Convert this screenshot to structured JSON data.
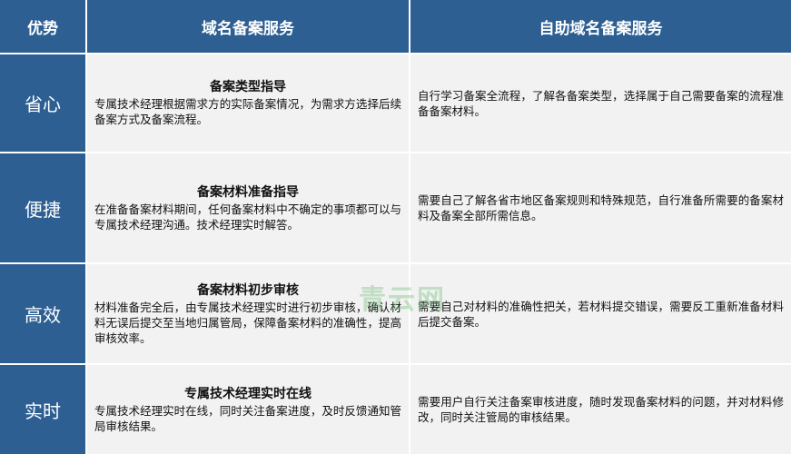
{
  "header": {
    "col1": "优势",
    "col2": "域名备案服务",
    "col3": "自助域名备案服务"
  },
  "rows": [
    {
      "advantage": "省心",
      "service_title": "备案类型指导",
      "service_desc": "专属技术经理根据需求方的实际备案情况，为需求方选择后续备案方式及备案流程。",
      "self_desc": "自行学习备案全流程，了解各备案类型，选择属于自己需要备案的流程准备备案材料。"
    },
    {
      "advantage": "便捷",
      "service_title": "备案材料准备指导",
      "service_desc": "在准备备案材料期间，任何备案材料中不确定的事项都可以与专属技术经理沟通。技术经理实时解答。",
      "self_desc": "需要自己了解各省市地区备案规则和特殊规范，自行准备所需要的备案材料及备案全部所需信息。"
    },
    {
      "advantage": "高效",
      "service_title": "备案材料初步审核",
      "service_desc": "材料准备完全后，由专属技术经理实时进行初步审核，确认材料无误后提交至当地归属管局，保障备案材料的准确性，提高审核效率。",
      "self_desc": "需要自己对材料的准确性把关，若材料提交错误，需要反工重新准备材料后提交备案。"
    },
    {
      "advantage": "实时",
      "service_title": "专属技术经理实时在线",
      "service_desc": "专属技术经理实时在线，同时关注备案进度，及时反馈通知管局审核结果。",
      "self_desc": "需要用户自行关注备案审核进度，随时发现备案材料的问题，并对材料修改，同时关注管局的审核结果。"
    }
  ],
  "watermark": "青云网"
}
